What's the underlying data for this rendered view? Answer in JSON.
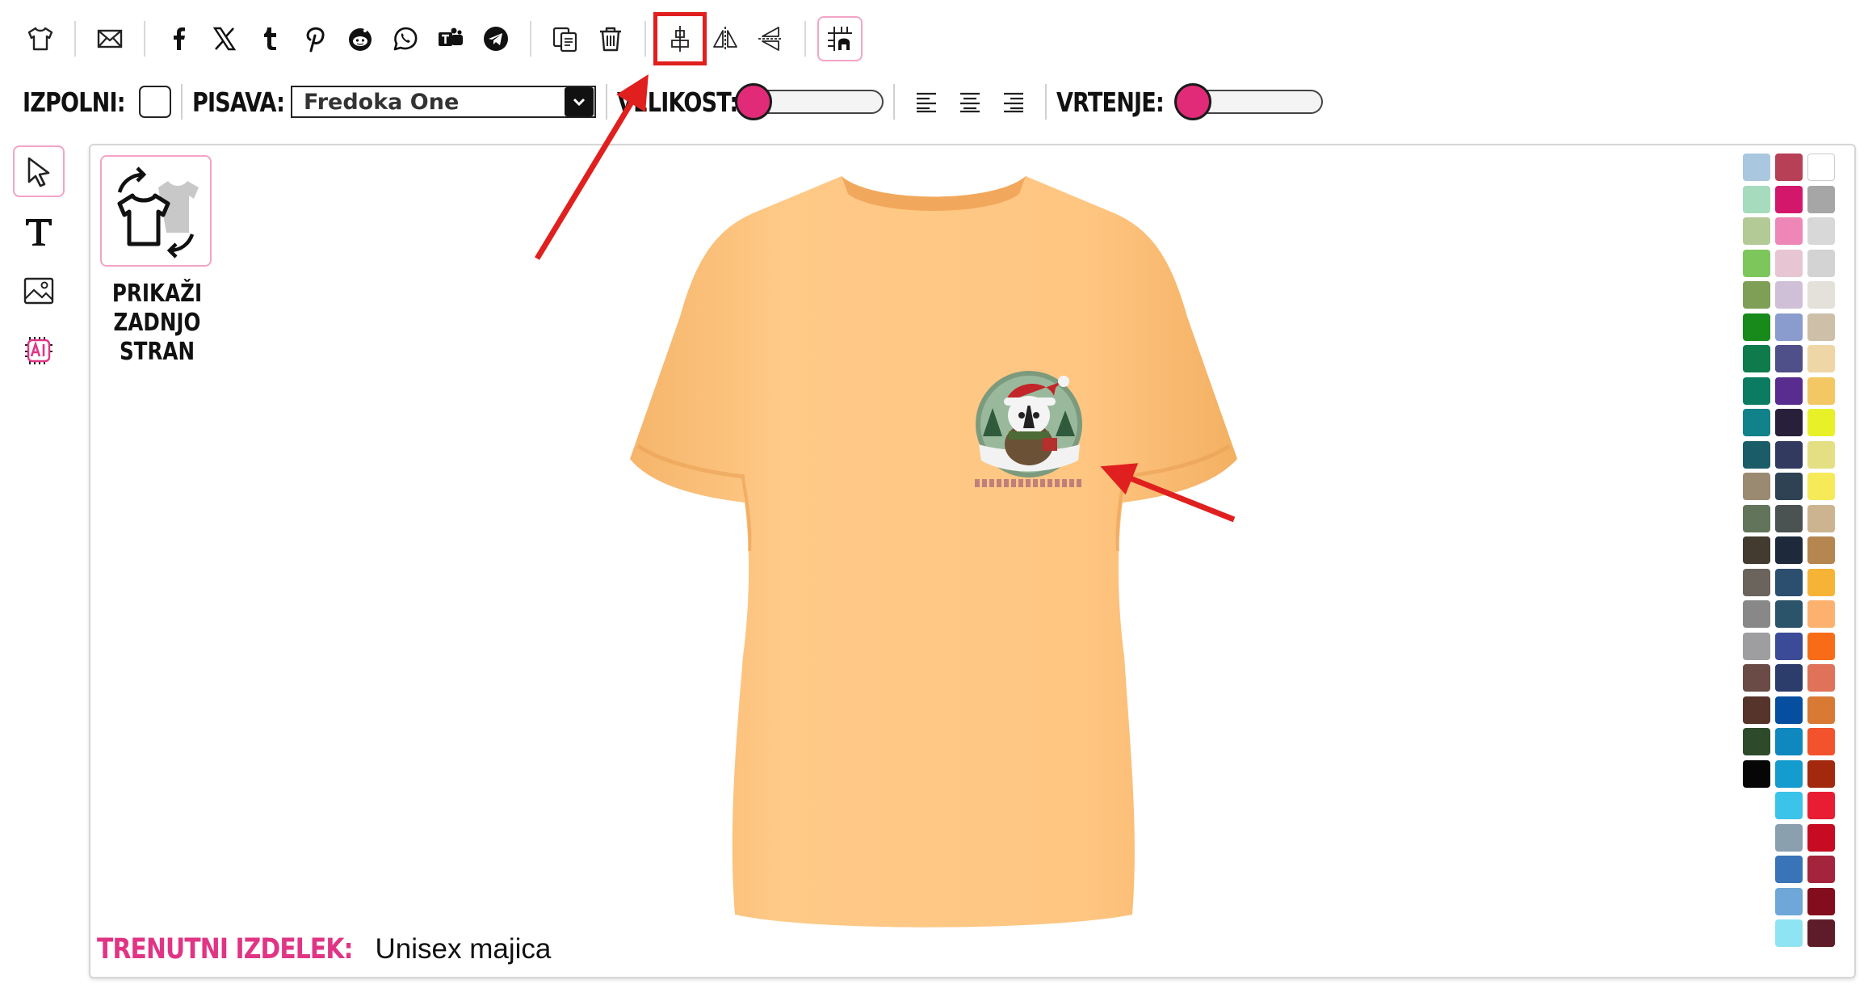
{
  "toolbar": {
    "icons": [
      "tshirt-icon",
      "mail-icon",
      "facebook-icon",
      "x-icon",
      "tumblr-icon",
      "pinterest-icon",
      "reddit-icon",
      "whatsapp-icon",
      "teams-icon",
      "telegram-icon",
      "duplicate-icon",
      "trash-icon",
      "center-align-icon",
      "flip-horizontal-icon",
      "flip-vertical-icon",
      "grid-snap-icon"
    ]
  },
  "options": {
    "fill_label": "IZPOLNI:",
    "font_label": "PISAVA:",
    "font_value": "Fredoka One",
    "size_label": "VELIKOST:",
    "size_value": 0,
    "rotation_label": "VRTENJE:",
    "rotation_value": 0
  },
  "left_tools": [
    "pointer-icon",
    "text-icon",
    "image-icon",
    "ai-icon"
  ],
  "canvas": {
    "back_side_label_1": "PRIKAŽI",
    "back_side_label_2": "ZADNJO",
    "back_side_label_3": "STRAN",
    "current_product_label": "TRENUTNI IZDELEK:",
    "current_product_value": "Unisex majica",
    "shirt_color": "#fdc37e"
  },
  "palette": {
    "columns": [
      [
        "#a9c7de",
        "#a6dcbd",
        "#b3c996",
        "#7dc65c",
        "#7e9f55",
        "#178a1b",
        "#0f7a4b",
        "#0b7c62",
        "#118289",
        "#1b5c69",
        "#9b8a72",
        "#62755a",
        "#433b30",
        "#6b645c",
        "#888888",
        "#9e9ea0",
        "#6b4b45",
        "#56342c",
        "#2d4a2b",
        "#060606"
      ],
      [
        "#b73f56",
        "#d3186b",
        "#ef86b8",
        "#e8c5d3",
        "#cfc0d8",
        "#8a9ccd",
        "#4f4f8a",
        "#592d8f",
        "#28203a",
        "#323a60",
        "#2f4254",
        "#4a5352",
        "#1e2a3c",
        "#2c4f70",
        "#2b5369",
        "#3c4b97",
        "#2c3c6b",
        "#064fa0",
        "#0f88bf",
        "#159ccf",
        "#3bc3ea",
        "#8aa0ae",
        "#3874b7",
        "#6ea7d8",
        "#8fe4f3"
      ],
      [
        "#ffffff",
        "#a6a6a6",
        "#d8d8d8",
        "#d3d3d3",
        "#e4e1da",
        "#cdbfa8",
        "#efd6a6",
        "#f2c764",
        "#e8f028",
        "#e5df84",
        "#f7ea59",
        "#cdb491",
        "#b58650",
        "#f6b436",
        "#fcb16f",
        "#f96c17",
        "#e0725a",
        "#d87a34",
        "#f2522c",
        "#a3290e",
        "#e81d34",
        "#c70b22",
        "#a3243c",
        "#830d1c",
        "#5e1c2b"
      ]
    ]
  }
}
